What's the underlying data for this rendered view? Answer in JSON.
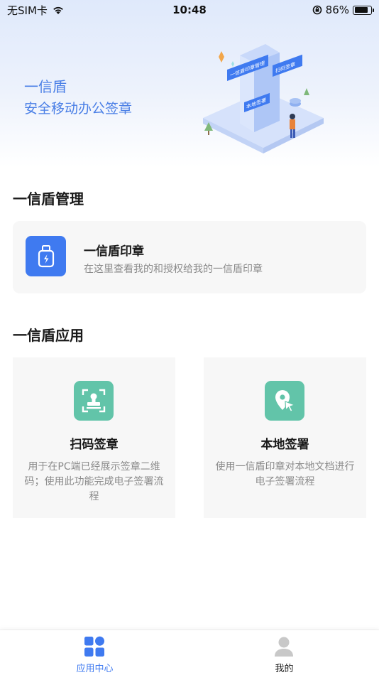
{
  "status_bar": {
    "carrier": "无SIM卡",
    "time": "10:48",
    "battery_percent": "86%",
    "battery_level": 0.86
  },
  "banner": {
    "title": "一信盾",
    "subtitle": "安全移动办公签章",
    "illustration_labels": [
      "一信盾印章管理",
      "扫码签章",
      "本地签署"
    ]
  },
  "management": {
    "section_title": "一信盾管理",
    "card": {
      "icon": "usb-key-icon",
      "title": "一信盾印章",
      "description": "在这里查看我的和授权给我的一信盾印章"
    }
  },
  "applications": {
    "section_title": "一信盾应用",
    "cards": [
      {
        "icon": "scan-stamp-icon",
        "title": "扫码签章",
        "description": "用于在PC端已经展示签章二维码；使用此功能完成电子签署流程"
      },
      {
        "icon": "location-pointer-icon",
        "title": "本地签署",
        "description": "使用一信盾印章对本地文档进行电子签署流程"
      }
    ]
  },
  "tab_bar": {
    "tabs": [
      {
        "label": "应用中心",
        "icon": "grid-icon",
        "active": true
      },
      {
        "label": "我的",
        "icon": "user-icon",
        "active": false
      }
    ]
  },
  "colors": {
    "brand_blue": "#3f7af0",
    "banner_text": "#4a7fe6",
    "app_icon_green": "#62c4a9",
    "card_bg": "#f7f7f7",
    "muted_text": "#8a8a8a"
  }
}
